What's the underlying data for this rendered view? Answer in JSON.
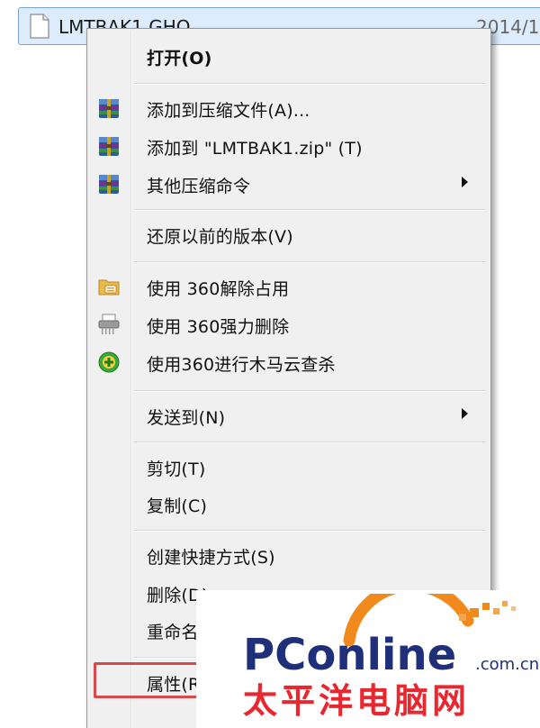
{
  "explorer": {
    "file_name": "LMTBAK1.GHO",
    "file_date": "2014/1"
  },
  "context_menu": {
    "items": [
      {
        "label": "打开(O)",
        "bold": true
      },
      {
        "label": "添加到压缩文件(A)...",
        "icon": "archive-icon"
      },
      {
        "label": "添加到 \"LMTBAK1.zip\" (T)",
        "icon": "archive-icon"
      },
      {
        "label": "其他压缩命令",
        "icon": "archive-icon",
        "submenu": true
      },
      {
        "label": "还原以前的版本(V)"
      },
      {
        "label": "使用 360解除占用",
        "icon": "folder-unlock-icon"
      },
      {
        "label": "使用 360强力删除",
        "icon": "shredder-icon"
      },
      {
        "label": "使用360进行木马云查杀",
        "icon": "360-scan-icon"
      },
      {
        "label": "发送到(N)",
        "submenu": true
      },
      {
        "label": "剪切(T)"
      },
      {
        "label": "复制(C)"
      },
      {
        "label": "创建快捷方式(S)"
      },
      {
        "label": "删除(D)"
      },
      {
        "label": "重命名(M)"
      },
      {
        "label": "属性(R)"
      }
    ]
  },
  "watermark": {
    "brand": "PConline",
    "domain": ".com.cn",
    "chinese": "太平洋电脑网"
  },
  "colors": {
    "menu_bg": "#f0f0f0",
    "selection_bg": "#dcecfc",
    "highlight_border": "#d94b4b",
    "brand_blue": "#1f2f7a",
    "brand_red": "#e8272f",
    "brand_orange": "#f08a1c"
  }
}
